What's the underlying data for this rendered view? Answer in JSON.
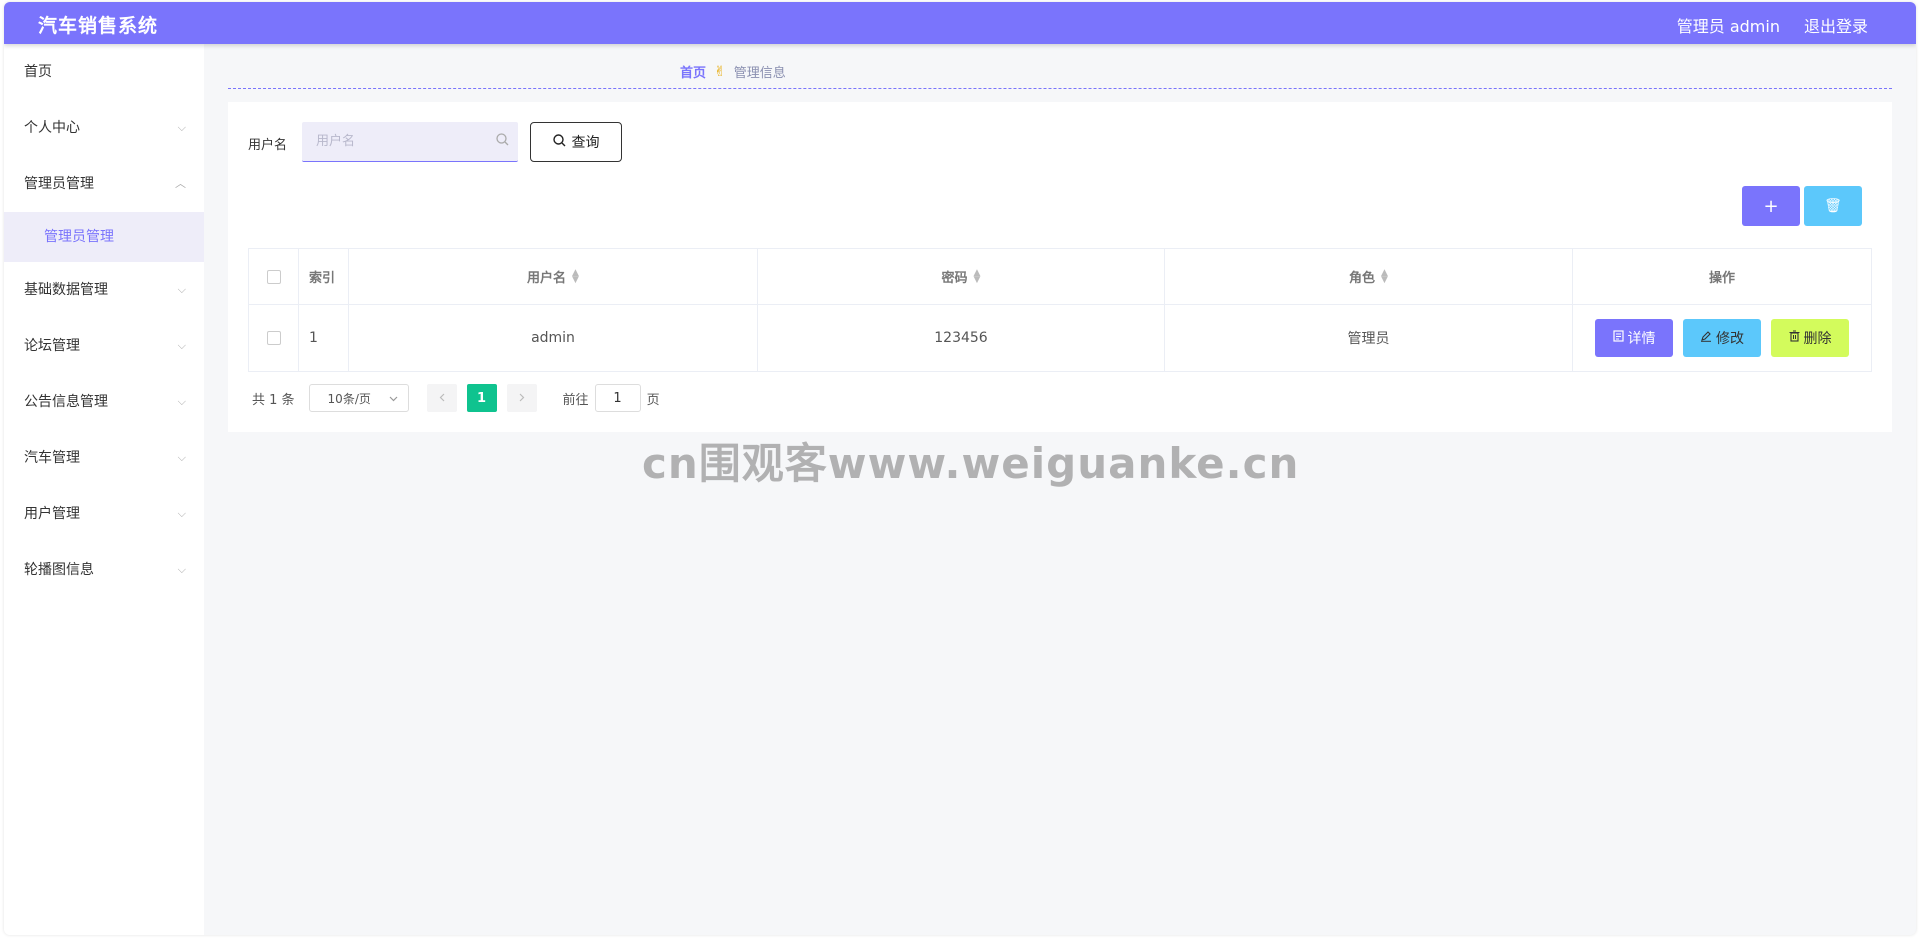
{
  "header": {
    "app_title": "汽车销售系统",
    "user_label": "管理员 admin",
    "logout_label": "退出登录"
  },
  "sidebar": {
    "items": [
      {
        "label": "首页",
        "has_chevron": false
      },
      {
        "label": "个人中心",
        "chevron": "⌵"
      },
      {
        "label": "管理员管理",
        "chevron": "︿"
      },
      {
        "label": "管理员管理",
        "sub": true
      },
      {
        "label": "基础数据管理",
        "chevron": "⌵"
      },
      {
        "label": "论坛管理",
        "chevron": "⌵"
      },
      {
        "label": "公告信息管理",
        "chevron": "⌵"
      },
      {
        "label": "汽车管理",
        "chevron": "⌵"
      },
      {
        "label": "用户管理",
        "chevron": "⌵"
      },
      {
        "label": "轮播图信息",
        "chevron": "⌵"
      }
    ]
  },
  "breadcrumb": {
    "home": "首页",
    "separator_icon": "✌",
    "current": "管理信息"
  },
  "search": {
    "label": "用户名",
    "placeholder": "用户名",
    "query_label": "查询"
  },
  "table": {
    "columns": [
      "索引",
      "用户名",
      "密码",
      "角色",
      "操作"
    ],
    "rows": [
      {
        "index": "1",
        "username": "admin",
        "password": "123456",
        "role": "管理员"
      }
    ],
    "actions": {
      "detail": "详情",
      "edit": "修改",
      "delete": "删除"
    }
  },
  "toolbar": {
    "add_icon": "+",
    "delete_icon": "🗑"
  },
  "pagination": {
    "total": "共 1 条",
    "page_size": "10条/页",
    "current_page": "1",
    "goto_label": "前往",
    "goto_value": "1",
    "page_suffix": "页"
  },
  "watermark": "cn围观客www.weiguanke.cn",
  "colors": {
    "primary": "#7a74fc",
    "info": "#5cc8fb",
    "lime": "#d3fb5c",
    "active_page": "#0fc38f"
  }
}
